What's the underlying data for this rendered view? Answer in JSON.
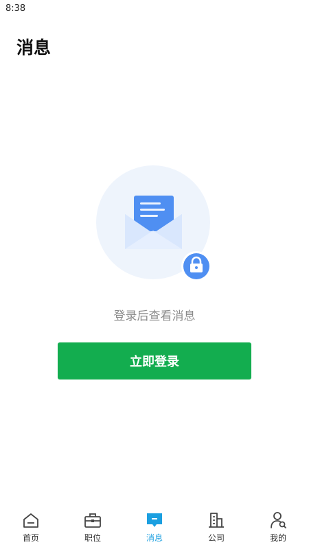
{
  "status_bar": {
    "time": "8:38"
  },
  "header": {
    "title": "消息"
  },
  "empty_state": {
    "illustration_icon": "envelope-lock-icon",
    "hint": "登录后查看消息",
    "login_label": "立即登录"
  },
  "tabs": [
    {
      "label": "首页",
      "icon": "home-icon"
    },
    {
      "label": "职位",
      "icon": "briefcase-icon"
    },
    {
      "label": "消息",
      "icon": "message-icon",
      "active": true
    },
    {
      "label": "公司",
      "icon": "building-icon"
    },
    {
      "label": "我的",
      "icon": "profile-search-icon"
    }
  ],
  "colors": {
    "accent_green": "#13ad4f",
    "active_tab": "#1b9fe0",
    "envelope_blue": "#4a90f0",
    "illustration_bg": "#eef4fc"
  }
}
